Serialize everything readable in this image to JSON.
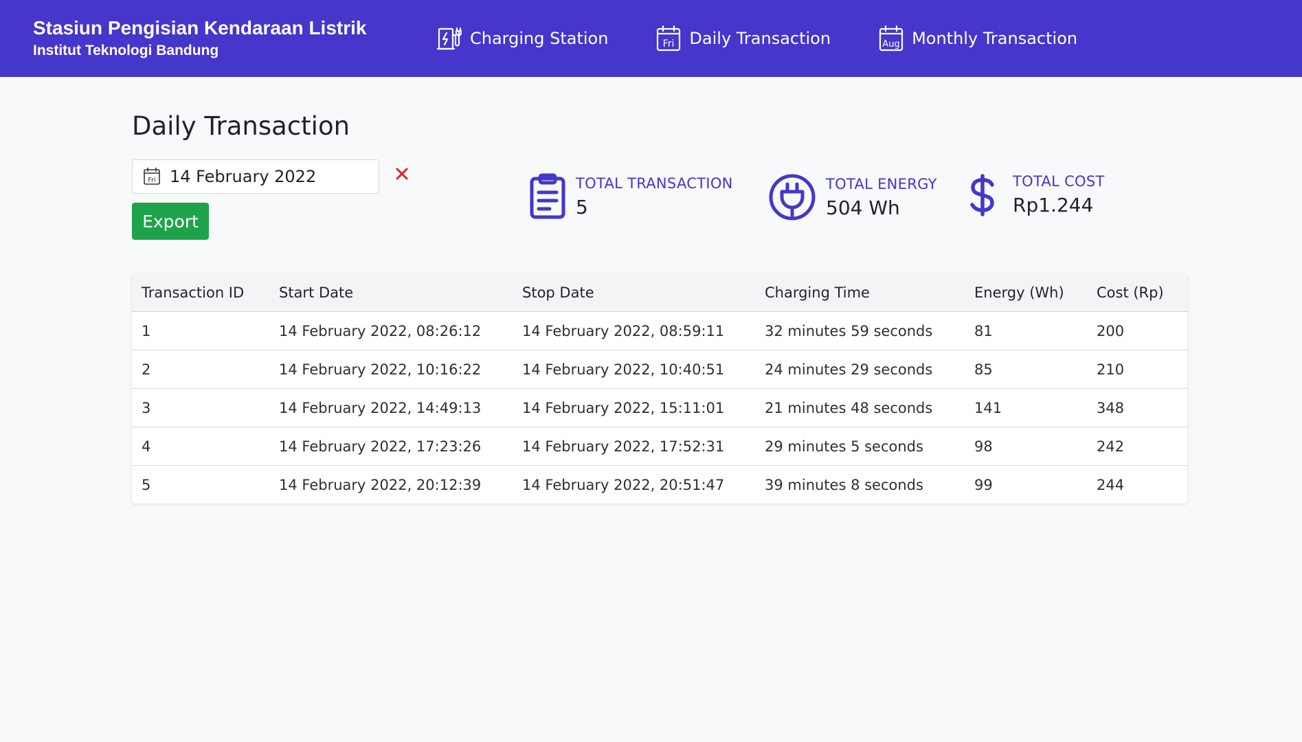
{
  "header": {
    "title": "Stasiun Pengisian Kendaraan Listrik",
    "subtitle": "Institut Teknologi Bandung",
    "nav": [
      {
        "label": "Charging Station",
        "icon": "charging-station-icon"
      },
      {
        "label": "Daily Transaction",
        "icon": "calendar-day-icon",
        "icon_text": "Fri"
      },
      {
        "label": "Monthly Transaction",
        "icon": "calendar-month-icon",
        "icon_text": "Aug"
      }
    ]
  },
  "page": {
    "title": "Daily Transaction",
    "date_picker": {
      "value": "14 February 2022",
      "icon": "calendar-icon",
      "icon_text": "Fri"
    },
    "clear_icon": "close-icon",
    "export_label": "Export"
  },
  "stats": {
    "transaction": {
      "label": "TOTAL TRANSACTION",
      "value": "5",
      "icon": "clipboard-icon"
    },
    "energy": {
      "label": "TOTAL ENERGY",
      "value": "504 Wh",
      "icon": "plug-icon"
    },
    "cost": {
      "label": "TOTAL COST",
      "value": "Rp1.244",
      "icon": "dollar-icon"
    }
  },
  "table": {
    "headers": [
      "Transaction ID",
      "Start Date",
      "Stop Date",
      "Charging Time",
      "Energy (Wh)",
      "Cost (Rp)"
    ],
    "rows": [
      [
        "1",
        "14 February 2022, 08:26:12",
        "14 February 2022, 08:59:11",
        "32 minutes 59 seconds",
        "81",
        "200"
      ],
      [
        "2",
        "14 February 2022, 10:16:22",
        "14 February 2022, 10:40:51",
        "24 minutes 29 seconds",
        "85",
        "210"
      ],
      [
        "3",
        "14 February 2022, 14:49:13",
        "14 February 2022, 15:11:01",
        "21 minutes 48 seconds",
        "141",
        "348"
      ],
      [
        "4",
        "14 February 2022, 17:23:26",
        "14 February 2022, 17:52:31",
        "29 minutes 5 seconds",
        "98",
        "242"
      ],
      [
        "5",
        "14 February 2022, 20:12:39",
        "14 February 2022, 20:51:47",
        "39 minutes 8 seconds",
        "99",
        "244"
      ]
    ]
  },
  "colors": {
    "primary": "#4536cc",
    "success": "#1fa34a",
    "danger": "#dc2626",
    "background": "#f8f9fb"
  }
}
